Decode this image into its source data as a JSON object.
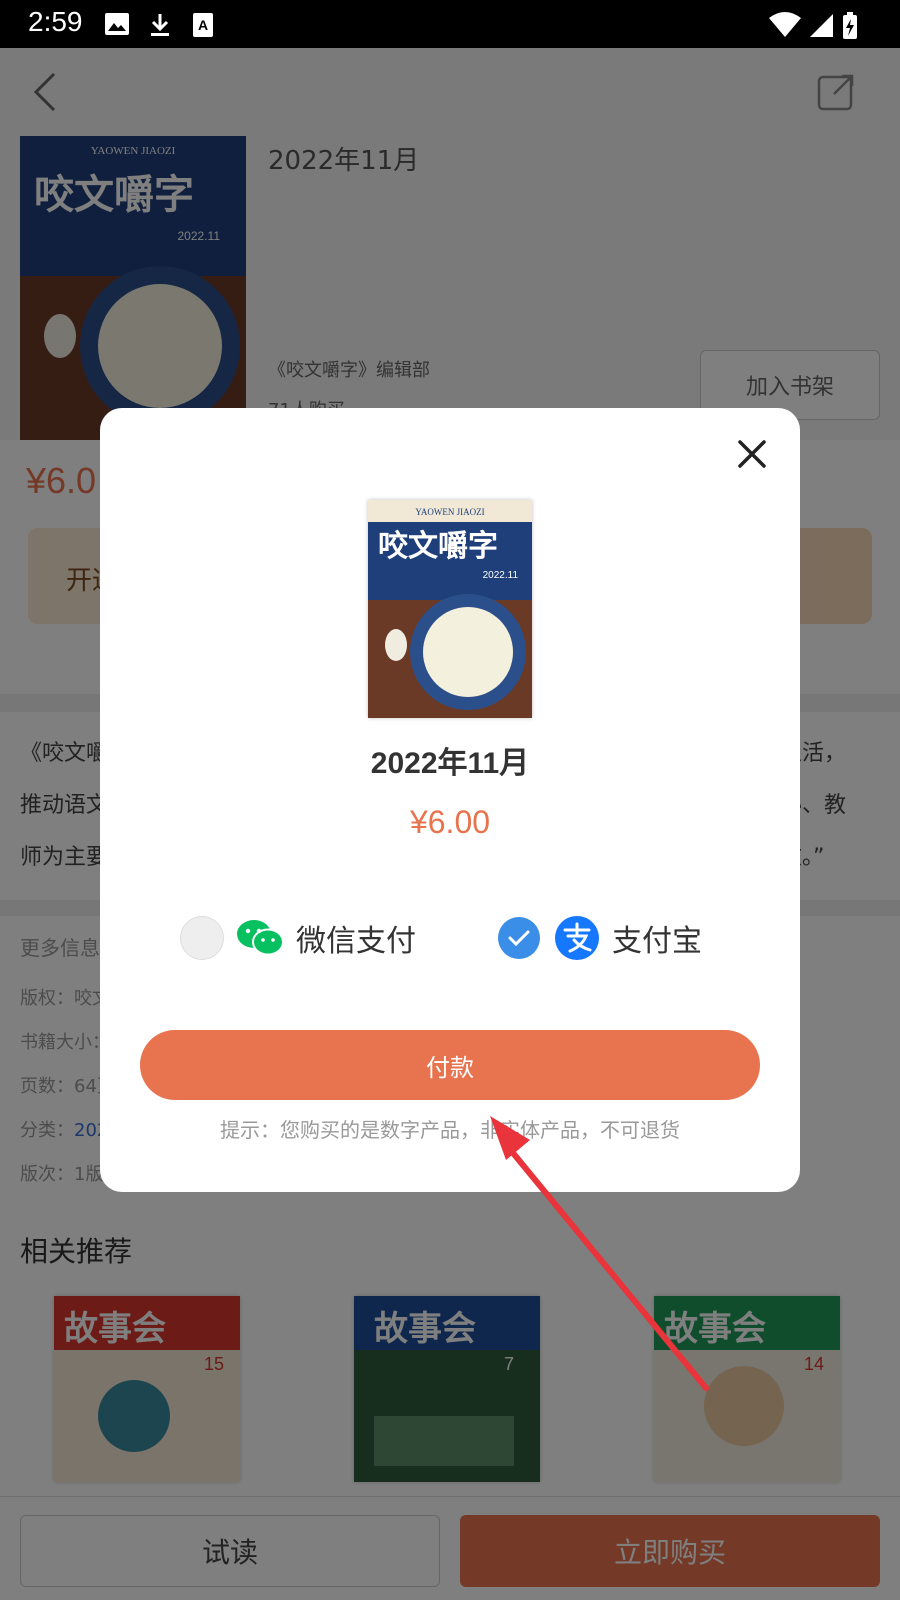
{
  "status_bar": {
    "time": "2:59"
  },
  "book": {
    "title": "2022年11月",
    "author": "《咬文嚼字》编辑部",
    "buyers": "71人购买",
    "price": "¥6.0",
    "add_shelf_label": "加入书架",
    "vip_label": "开通"
  },
  "cover": {
    "pinyin": "YAOWEN JIAOZI",
    "brand": "咬文嚼字",
    "issue": "2022.11"
  },
  "description": {
    "lines": [
      "《咬文嚼",
      "推动语文",
      "师为主要"
    ],
    "right_lines": [
      "生活，",
      "秘、教",
      "文。”"
    ]
  },
  "more_info": {
    "title": "更多信息",
    "copyright": "版权：咬文",
    "size": "书籍大小：",
    "pages": "页数：64页",
    "category_label": "分类：",
    "category_link": "202",
    "edition": "版次：1版"
  },
  "related": {
    "title": "相关推荐",
    "books": [
      {
        "brand": "故事会",
        "issue": "15",
        "color": "#d8372c"
      },
      {
        "brand": "故事会",
        "issue": "7",
        "color": "#1f4f9a"
      },
      {
        "brand": "故事会",
        "issue": "14",
        "color": "#1f9a5a"
      }
    ]
  },
  "bottom": {
    "try_label": "试读",
    "buy_label": "立即购买"
  },
  "modal": {
    "title": "2022年11月",
    "price": "¥6.00",
    "wechat_label": "微信支付",
    "alipay_label": "支付宝",
    "pay_label": "付款",
    "tip": "提示：您购买的是数字产品，非实体产品，不可退货",
    "selected_method": "alipay"
  },
  "colors": {
    "accent": "#e8734f",
    "alipay": "#1677ff",
    "wechat": "#07c160",
    "check": "#3b8ee8"
  }
}
